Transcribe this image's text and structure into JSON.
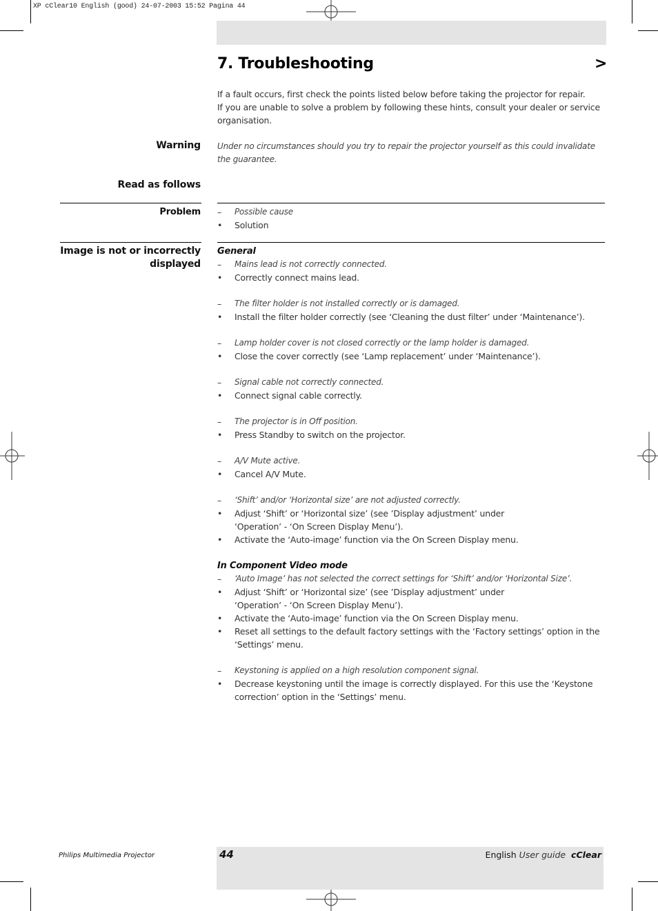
{
  "slug": "XP cClear10 English (good) 24-07-2003 15:52 Pagina 44",
  "header": {
    "title": "7. Troubleshooting",
    "arrow": ">"
  },
  "intro": {
    "line1": "If a fault occurs, first check the points listed below before taking the projector for repair.",
    "line2": "If you are unable to solve a problem by following these hints, consult your dealer or service organisation."
  },
  "warning": {
    "label": "Warning",
    "text": "Under no circumstances should you try to repair the projector yourself as this could invalidate the guarantee."
  },
  "read_as_follows": {
    "label": "Read as follows"
  },
  "legend": {
    "label": "Problem",
    "cause_marker": "–",
    "cause": "Possible cause",
    "solution_marker": "•",
    "solution": "Solution"
  },
  "problem": {
    "label": "Image is not or incorrectly displayed",
    "sections": [
      {
        "heading": "General",
        "items": [
          {
            "cause": "Mains lead is not correctly connected.",
            "solutions": [
              "Correctly connect mains lead."
            ]
          },
          {
            "cause": "The filter holder is not installed correctly or is damaged.",
            "solutions": [
              "Install the filter holder correctly (see ‘Cleaning the dust filter’ under ‘Maintenance’)."
            ]
          },
          {
            "cause": "Lamp holder cover is not closed correctly or the lamp holder is damaged.",
            "solutions": [
              "Close the cover correctly (see ‘Lamp replacement’ under ‘Maintenance’)."
            ]
          },
          {
            "cause": "Signal cable not correctly connected.",
            "solutions": [
              "Connect signal cable correctly."
            ]
          },
          {
            "cause": "The projector is in Off position.",
            "solutions": [
              "Press Standby to switch on the projector."
            ]
          },
          {
            "cause": "A/V Mute active.",
            "solutions": [
              "Cancel A/V Mute."
            ]
          },
          {
            "cause": "‘Shift’ and/or ‘Horizontal size’ are not adjusted correctly.",
            "solutions": [
              "Adjust ‘Shift’ or ‘Horizontal size’ (see ’Display adjustment’ under",
              "‘Operation’ - ‘On Screen Display Menu’).",
              "Activate the ‘Auto-image’ function via the On Screen Display menu."
            ]
          }
        ]
      },
      {
        "heading": "In Component Video mode",
        "items": [
          {
            "cause": "‘Auto Image’ has not selected the correct settings for ‘Shift’ and/or ‘Horizontal Size’.",
            "solutions": [
              "Adjust ‘Shift’ or ‘Horizontal size’ (see ’Display adjustment’ under",
              "‘Operation’ - ‘On Screen Display Menu’).",
              "Activate the ‘Auto-image’ function via the On Screen Display menu.",
              "Reset all settings to the default factory settings with the ‘Factory settings’ option in the",
              "‘Settings’ menu."
            ]
          },
          {
            "cause": "Keystoning is applied on a high resolution component signal.",
            "solutions": [
              "Decrease keystoning until the image is correctly displayed. For this use  the ‘Keystone",
              "correction’ option in the ‘Settings’ menu."
            ]
          }
        ]
      }
    ]
  },
  "footer": {
    "product": "Philips Multimedia Projector",
    "page_number": "44",
    "language": "English",
    "guide": "User guide",
    "brand": "cClear"
  },
  "markers": {
    "cause": "–",
    "solution": "•"
  }
}
